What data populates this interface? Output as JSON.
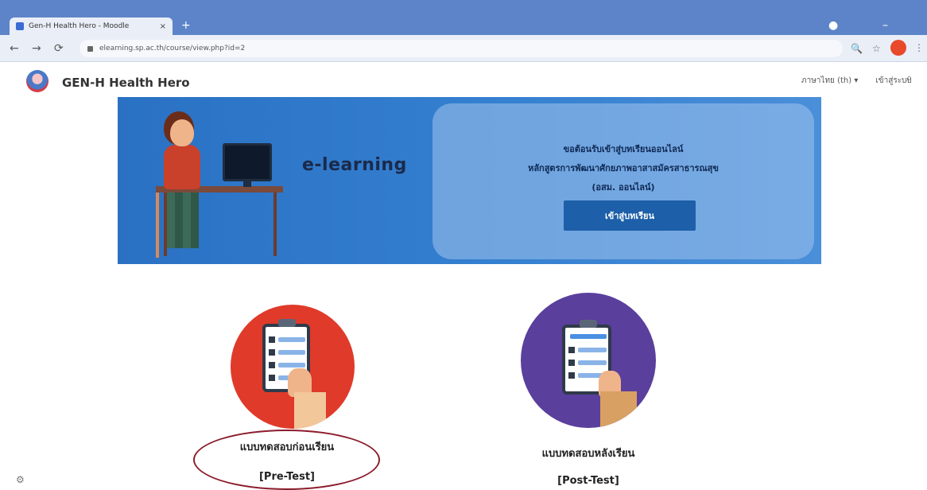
{
  "browser": {
    "tab_title": "Gen-H Health Hero - Moodle",
    "tab_close": "×",
    "new_tab": "+",
    "url": "elearning.sp.ac.th/course/view.php?id=2",
    "back": "←",
    "forward": "→",
    "reload": "⟳",
    "zoom_icon": "🔍",
    "star_icon": "☆",
    "menu": "⋮"
  },
  "site": {
    "title": "GEN-H Health Hero",
    "nav": [
      "ภาษาไทย ‎(th)‎ ▾",
      "เข้าสู่ระบบ"
    ],
    "search_icon": "⌕"
  },
  "banner": {
    "heading": "e-learning",
    "lines": [
      "ขอต้อนรับเข้าสู่บทเรียนออนไลน์",
      "หลักสูตรการพัฒนาศักยภาพอาสาสมัครสาธารณสุข",
      "(อสม. ออนไลน์)"
    ],
    "button_label": "เข้าสู่บทเรียน"
  },
  "tests": [
    {
      "label": "แบบทดสอบก่อนเรียน",
      "sub": "[Pre-Test]",
      "color": "#e03a2a"
    },
    {
      "label": "แบบทดสอบหลังเรียน",
      "sub": "[Post-Test]",
      "color": "#5a3f9c"
    }
  ],
  "footer": {
    "gear": "⚙"
  }
}
